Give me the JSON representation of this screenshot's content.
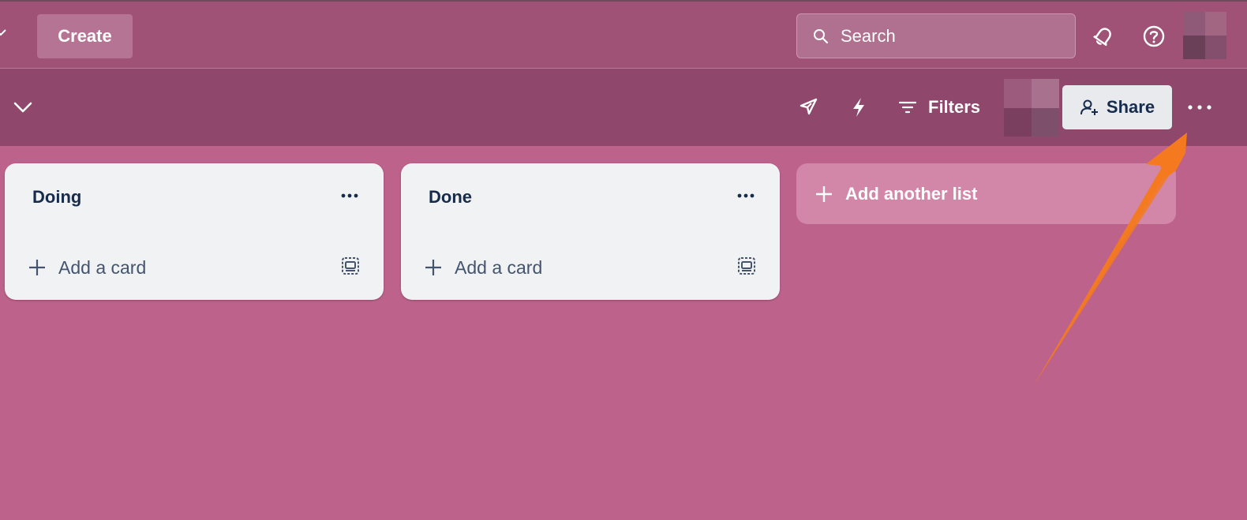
{
  "topbar": {
    "create_label": "Create",
    "search_placeholder": "Search",
    "icons": [
      "chevron-down-icon",
      "search-icon",
      "notification-bell-icon",
      "help-icon"
    ],
    "avatar_colors": [
      "#8f5a78",
      "#a26683",
      "#6a3f58",
      "#844f6d"
    ]
  },
  "boardbar": {
    "filters_label": "Filters",
    "share_label": "Share",
    "icons": [
      "board-menu-chevron-icon",
      "power-ups-rocket-icon",
      "automation-bolt-icon",
      "filter-icon",
      "add-person-icon",
      "more-horizontal-icon"
    ],
    "avatar_colors": [
      "#9c5b7c",
      "#a8728f",
      "#7a3f5f",
      "#7e4f6b"
    ]
  },
  "lists": [
    {
      "title": "Doing",
      "add_card_label": "Add a card"
    },
    {
      "title": "Done",
      "add_card_label": "Add a card"
    }
  ],
  "add_list_label": "Add another list",
  "colors": {
    "topbar_bg": "#9f5276",
    "boardbar_bg": "#8f476b",
    "canvas_bg": "#bd628b",
    "list_bg": "#f1f2f4",
    "text_dark": "#172b4d",
    "annotation_arrow": "#f57a1f"
  }
}
